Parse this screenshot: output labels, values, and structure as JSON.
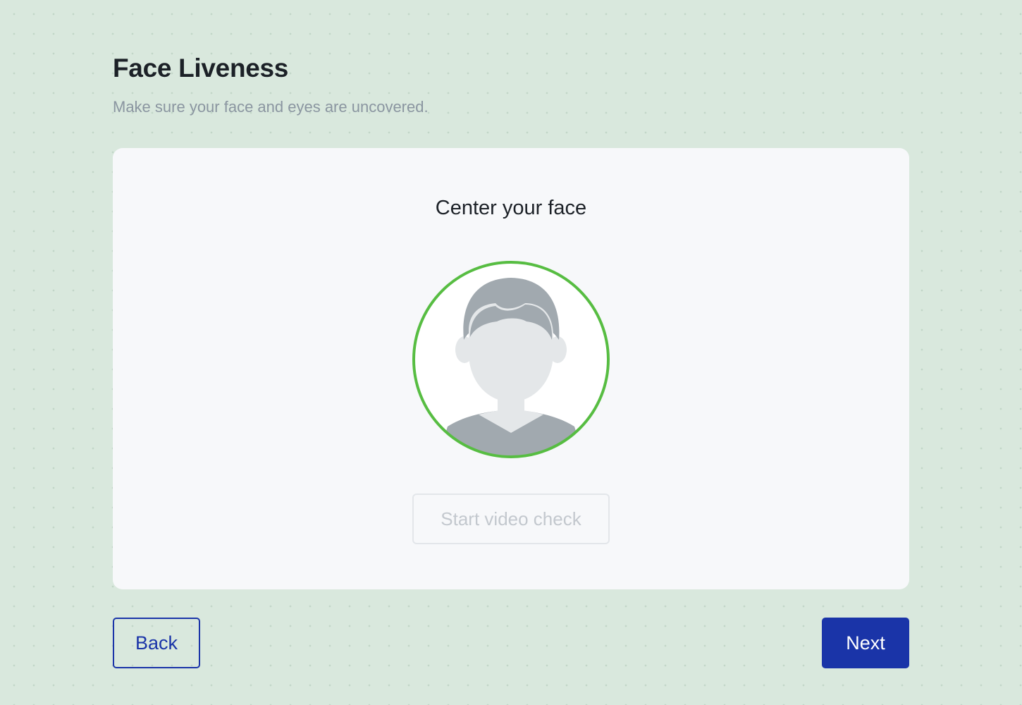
{
  "header": {
    "title": "Face Liveness",
    "subtitle": "Make sure your face and eyes are uncovered."
  },
  "card": {
    "heading": "Center your face",
    "start_button_label": "Start video check",
    "start_button_enabled": false,
    "avatar_icon": "user-silhouette-icon",
    "frame_status": "face-detected"
  },
  "footer": {
    "back_label": "Back",
    "next_label": "Next"
  },
  "colors": {
    "page_background": "#d9e8dd",
    "card_background": "#f7f8fa",
    "frame_ring": "#57bd42",
    "primary": "#1a34a8",
    "avatar_fill": "#e4e7e9",
    "avatar_shade": "#a1a9af"
  }
}
